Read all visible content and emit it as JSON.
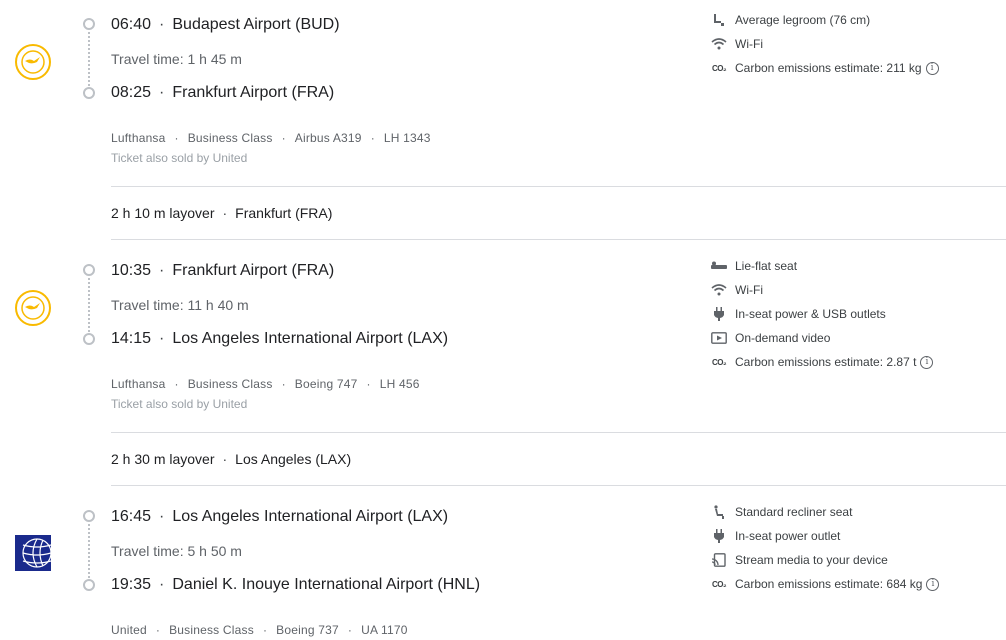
{
  "segments": [
    {
      "airline_logo": "lufthansa-crane-logo",
      "depart": {
        "time": "06:40",
        "airport": "Budapest Airport (BUD)"
      },
      "travel_time": "Travel time: 1 h 45 m",
      "arrive": {
        "time": "08:25",
        "airport": "Frankfurt Airport (FRA)"
      },
      "details": [
        "Lufthansa",
        "Business Class",
        "Airbus A319",
        "LH 1343"
      ],
      "sold_by": "Ticket also sold by United",
      "amenities": [
        {
          "icon": "legroom-icon",
          "label": "Average legroom (76 cm)"
        },
        {
          "icon": "wifi-icon",
          "label": "Wi-Fi"
        },
        {
          "icon": "co2-icon",
          "label": "Carbon emissions estimate: 211 kg",
          "info": true
        }
      ]
    },
    {
      "airline_logo": "lufthansa-crane-logo",
      "depart": {
        "time": "10:35",
        "airport": "Frankfurt Airport (FRA)"
      },
      "travel_time": "Travel time: 11 h 40 m",
      "arrive": {
        "time": "14:15",
        "airport": "Los Angeles International Airport (LAX)"
      },
      "details": [
        "Lufthansa",
        "Business Class",
        "Boeing 747",
        "LH 456"
      ],
      "sold_by": "Ticket also sold by United",
      "amenities": [
        {
          "icon": "lie-flat-seat-icon",
          "label": "Lie-flat seat"
        },
        {
          "icon": "wifi-icon",
          "label": "Wi-Fi"
        },
        {
          "icon": "power-plug-icon",
          "label": "In-seat power & USB outlets"
        },
        {
          "icon": "video-icon",
          "label": "On-demand video"
        },
        {
          "icon": "co2-icon",
          "label": "Carbon emissions estimate: 2.87 t",
          "info": true
        }
      ]
    },
    {
      "airline_logo": "united-globe-logo",
      "depart": {
        "time": "16:45",
        "airport": "Los Angeles International Airport (LAX)"
      },
      "travel_time": "Travel time: 5 h 50 m",
      "arrive": {
        "time": "19:35",
        "airport": "Daniel K. Inouye International Airport (HNL)"
      },
      "details": [
        "United",
        "Business Class",
        "Boeing 737",
        "UA 1170"
      ],
      "amenities": [
        {
          "icon": "recliner-seat-icon",
          "label": "Standard recliner seat"
        },
        {
          "icon": "power-plug-icon",
          "label": "In-seat power outlet"
        },
        {
          "icon": "stream-media-icon",
          "label": "Stream media to your device"
        },
        {
          "icon": "co2-icon",
          "label": "Carbon emissions estimate: 684 kg",
          "info": true
        }
      ]
    }
  ],
  "layovers": [
    {
      "duration": "2 h 10 m layover",
      "place": "Frankfurt (FRA)"
    },
    {
      "duration": "2 h 30 m layover",
      "place": "Los Angeles (LAX)"
    }
  ],
  "separator": "·",
  "co2_label": "CO₂",
  "info_glyph": "i",
  "colors": {
    "lufthansa": "#f9ba00",
    "united": "#1a2a8c",
    "divider": "#dadce0"
  }
}
